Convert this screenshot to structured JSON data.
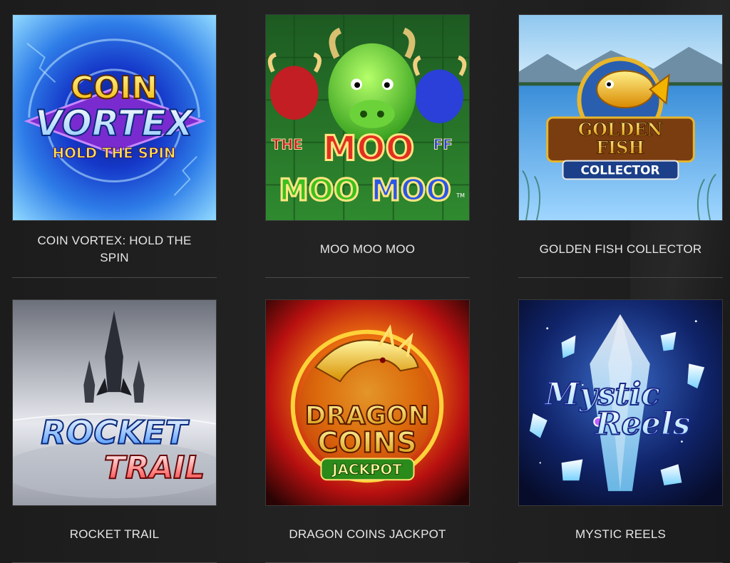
{
  "games": [
    {
      "title": "COIN VORTEX: HOLD THE SPIN",
      "art": {
        "line1": "COIN",
        "line2": "VORTEX",
        "line3": "HOLD THE SPIN"
      }
    },
    {
      "title": "MOO MOO MOO",
      "art": {
        "line1": "MOO",
        "line2": "MOO",
        "line3": "MOO",
        "left": "THE",
        "right": "FF",
        "tm": "TM"
      }
    },
    {
      "title": "GOLDEN FISH COLLECTOR",
      "art": {
        "line1": "GOLDEN",
        "line2": "FISH",
        "line3": "COLLECTOR"
      }
    },
    {
      "title": "ROCKET TRAIL",
      "art": {
        "line1": "ROCKET",
        "line2": "TRAIL"
      }
    },
    {
      "title": "DRAGON COINS JACKPOT",
      "art": {
        "line1": "DRAGON",
        "line2": "COINS",
        "line3": "JACKPOT"
      }
    },
    {
      "title": "MYSTIC REELS",
      "art": {
        "line1": "Mystic",
        "line2": "Reels"
      }
    }
  ],
  "colors": {
    "background": "#1f1f1f",
    "caption_text": "#e6e6e6",
    "divider": "#4a4a4a"
  }
}
